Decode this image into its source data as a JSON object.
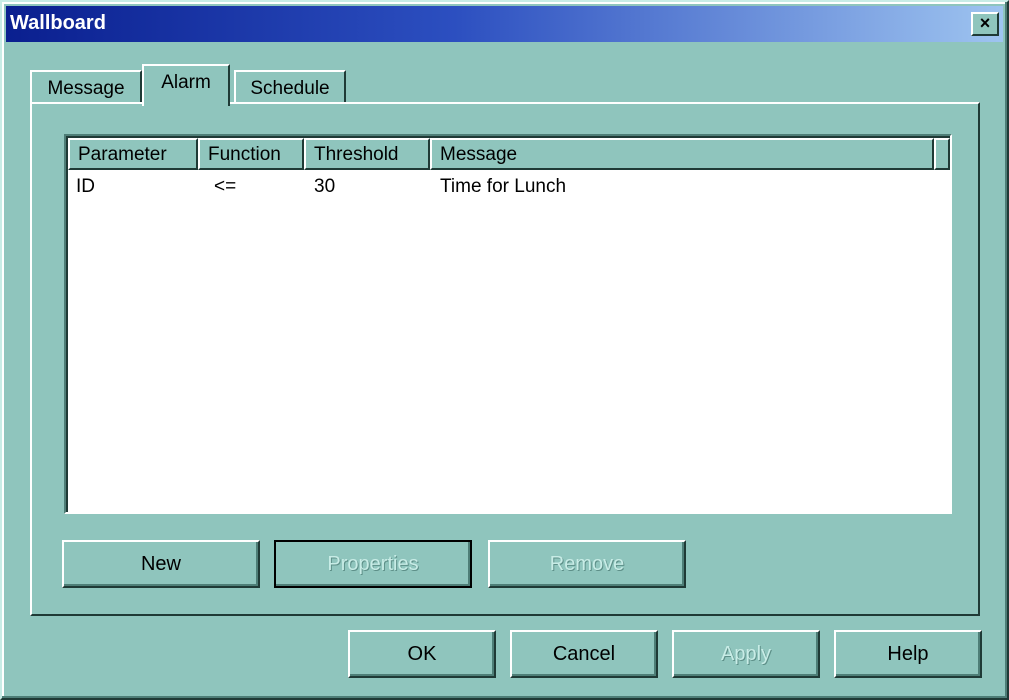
{
  "window": {
    "title": "Wallboard",
    "close_glyph": "×"
  },
  "tabs": [
    {
      "label": "Message",
      "active": false
    },
    {
      "label": "Alarm",
      "active": true
    },
    {
      "label": "Schedule",
      "active": false
    }
  ],
  "alarm_list": {
    "columns": [
      "Parameter",
      "Function",
      "Threshold",
      "Message"
    ],
    "rows": [
      {
        "parameter": "ID",
        "function": "<=",
        "threshold": "30",
        "message": "Time for Lunch"
      }
    ]
  },
  "panel_buttons": {
    "new": "New",
    "properties": "Properties",
    "remove": "Remove"
  },
  "dialog_buttons": {
    "ok": "OK",
    "cancel": "Cancel",
    "apply": "Apply",
    "help": "Help"
  },
  "colors": {
    "face": "#8fc5bd",
    "title_start": "#0a1f8f",
    "title_end": "#9ec4f0"
  }
}
